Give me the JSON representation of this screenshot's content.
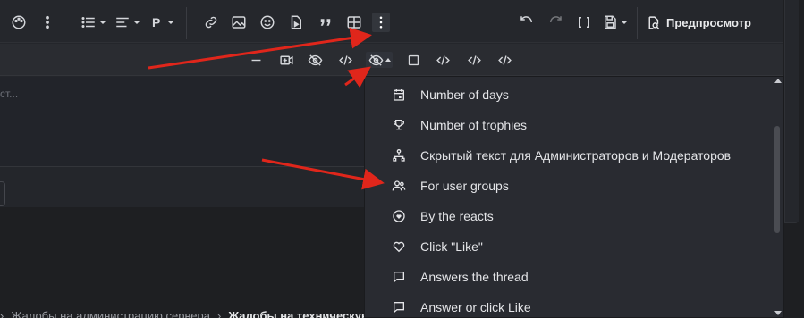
{
  "toolbar": {
    "paragraph_label": "P",
    "preview_label": "Предпросмотр"
  },
  "editor": {
    "placeholder": "ст..."
  },
  "dropdown": {
    "items": [
      {
        "icon": "calendar-icon",
        "label": "Number of days"
      },
      {
        "icon": "trophy-icon",
        "label": "Number of trophies"
      },
      {
        "icon": "hierarchy-icon",
        "label": "Скрытый текст для Администраторов и Модераторов"
      },
      {
        "icon": "users-icon",
        "label": "For user groups"
      },
      {
        "icon": "heart-circle-icon",
        "label": "By the reacts"
      },
      {
        "icon": "heart-outline-icon",
        "label": "Click \"Like\""
      },
      {
        "icon": "comment-icon",
        "label": "Answers the thread"
      },
      {
        "icon": "comment-icon",
        "label": "Answer or click Like"
      }
    ]
  },
  "breadcrumb": {
    "item1": "Жалобы на администрацию сервера",
    "item2": "Жалобы на техническую администрацию"
  },
  "colors": {
    "arrow": "#e0261b",
    "dropdown_bg": "#292b31",
    "toolbar_bg": "#25272c"
  }
}
